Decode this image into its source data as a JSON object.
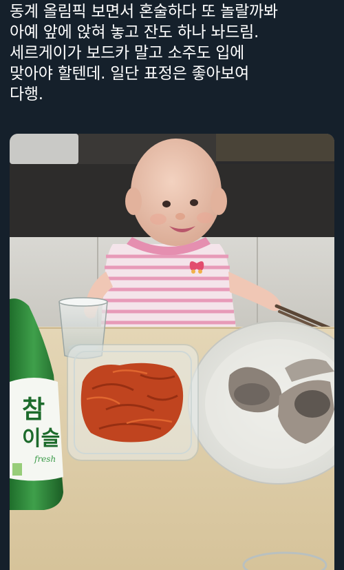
{
  "tweet": {
    "text_lines": [
      "동계 올림픽 보면서 혼술하다 또 놀랄까봐",
      "아예 앞에 앉혀 놓고 잔도 하나 놔드림.",
      "세르게이가 보드카 말고 소주도 입에",
      "맞아야 할텐데. 일단 표정은 좋아보여",
      "다행."
    ]
  },
  "photo": {
    "bottle_label": {
      "brand_line1": "참",
      "brand_line2": "이슬",
      "fresh_text": "fresh"
    }
  },
  "colors": {
    "background": "#15202b",
    "text": "#ffffff",
    "bottle_green": "#2e8b3a"
  }
}
